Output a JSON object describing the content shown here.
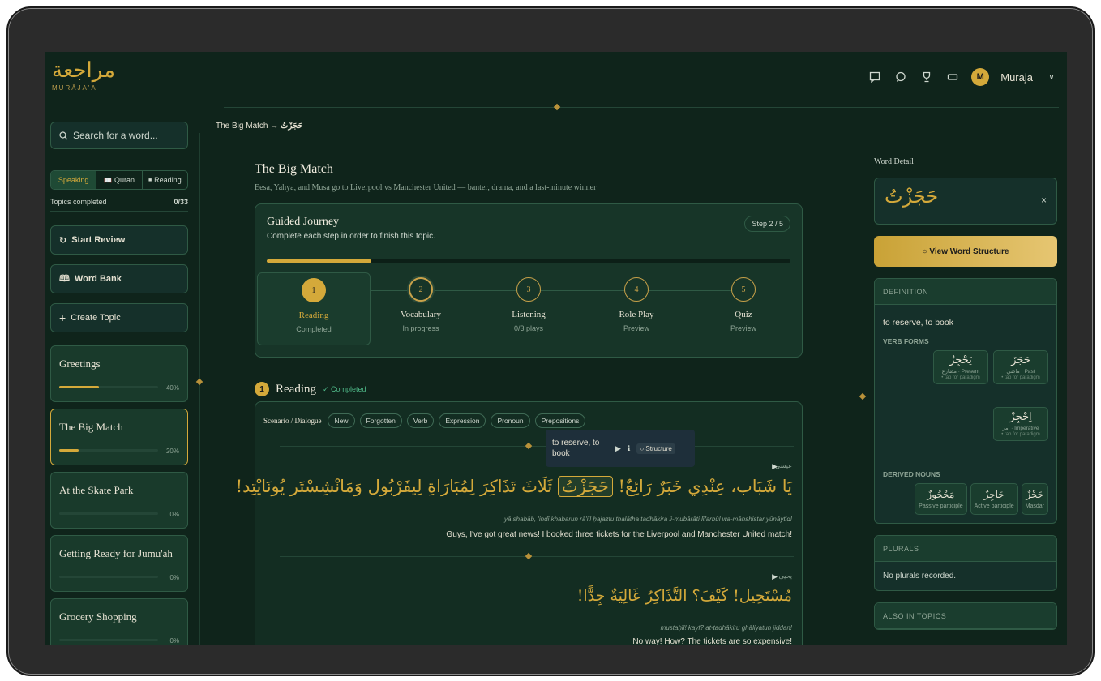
{
  "app": {
    "logo_ar": "مراجعة",
    "logo_en": "MURĀJA'A"
  },
  "header": {
    "icons": [
      "chat-icon",
      "message-icon",
      "trophy-icon",
      "card-icon"
    ],
    "avatar_initial": "M",
    "user_name": "Muraja",
    "chevron": "∨"
  },
  "sidebar": {
    "search_placeholder": "Search for a word...",
    "tabs": [
      {
        "label": "Speaking",
        "icon": ""
      },
      {
        "label": "Quran",
        "icon": "📖"
      },
      {
        "label": "Reading",
        "icon": "■"
      }
    ],
    "topics_completed_label": "Topics completed",
    "topics_completed_value": "0/33",
    "buttons": [
      {
        "label": "Start Review",
        "icon": "↻"
      },
      {
        "label": "Word Bank",
        "icon": "🕮"
      },
      {
        "label": "Create Topic",
        "icon": "+"
      }
    ],
    "topics": [
      {
        "name": "Greetings",
        "pct": "40%",
        "progress": 0.4
      },
      {
        "name": "The Big Match",
        "pct": "20%",
        "progress": 0.2
      },
      {
        "name": "At the Skate Park",
        "pct": "0%",
        "progress": 0
      },
      {
        "name": "Getting Ready for Jumu'ah",
        "pct": "0%",
        "progress": 0
      },
      {
        "name": "Grocery Shopping",
        "pct": "0%",
        "progress": 0
      }
    ]
  },
  "breadcrumb": {
    "parent": "The Big Match",
    "arrow": "→",
    "current": "حَجَزْتُ"
  },
  "topic": {
    "title": "The Big Match",
    "subtitle": "Eesa, Yahya, and Musa go to Liverpool vs Manchester United — banter, drama, and a last-minute winner"
  },
  "journey": {
    "title": "Guided Journey",
    "subtitle": "Complete each step in order to finish this topic.",
    "step_pill": "Step 2 / 5",
    "progress": 0.2,
    "steps": [
      {
        "num": "1",
        "name": "Reading",
        "status": "Completed"
      },
      {
        "num": "2",
        "name": "Vocabulary",
        "status": "In progress"
      },
      {
        "num": "3",
        "name": "Listening",
        "status": "0/3 plays"
      },
      {
        "num": "4",
        "name": "Role Play",
        "status": "Preview"
      },
      {
        "num": "5",
        "name": "Quiz",
        "status": "Preview"
      }
    ]
  },
  "reading": {
    "num": "1",
    "title": "Reading",
    "status": "✓ Completed",
    "filter_label": "Scenario / Dialogue",
    "chips": [
      "New",
      "Forgotten",
      "Verb",
      "Expression",
      "Pronoun",
      "Prepositions"
    ],
    "tooltip": {
      "text": "to reserve, to book",
      "play": "▶",
      "info": "ℹ",
      "structure": "○ Structure"
    },
    "lines": [
      {
        "speaker": "عيسى",
        "ar_before": "يَا شَبَاب، عِنْدِي خَبَرٌ رَائِعٌ!",
        "ar_word": "حَجَزْتُ",
        "ar_after": "ثَلَاثَ تَذَاكِرَ لِمُبَارَاةِ لِيفَرْبُول وَمَانْشِسْتَر يُونَايْتِد!",
        "translit": "yā shabāb, 'indī khabarun rā'i'! ḥajaztu thalātha tadhākira li-mubārāti līfarbūl wa-mānshistar yūnāytid!",
        "translation": "Guys, I've got great news! I booked three tickets for the Liverpool and Manchester United match!"
      },
      {
        "speaker": "يحيى",
        "ar": "مُسْتَحِيل! كَيْفَ؟ التَّذَاكِرُ غَالِيَةٌ جِدًّا!",
        "translit": "mustaḥīl! kayf? at-tadhākiru ghāliyatun jiddan!",
        "translation": "No way! How? The tickets are so expensive!"
      }
    ]
  },
  "word_detail": {
    "label": "Word Detail",
    "word": "حَجَزْتُ",
    "close": "×",
    "view_structure": "○ View Word Structure",
    "definition_h": "DEFINITION",
    "definition": "to reserve, to book",
    "verb_forms_h": "VERB FORMS",
    "verb_forms": [
      {
        "ar": "يَحْجِزُ",
        "label": "مضارع · Present",
        "hint": "• tap for paradigm"
      },
      {
        "ar": "حَجَزَ",
        "label": "ماضي · Past",
        "hint": "• tap for paradigm"
      },
      {
        "ar": "اِحْجِزْ",
        "label": "أمر · Imperative",
        "hint": "• tap for paradigm"
      }
    ],
    "derived_h": "DERIVED NOUNS",
    "derived": [
      {
        "ar": "مَحْجُوزٌ",
        "label": "Passive participle"
      },
      {
        "ar": "حَاجِزٌ",
        "label": "Active participle"
      },
      {
        "ar": "حَجْزٌ",
        "label": "Masdar"
      }
    ],
    "plurals_h": "PLURALS",
    "plurals": "No plurals recorded.",
    "also_h": "ALSO IN TOPICS"
  }
}
